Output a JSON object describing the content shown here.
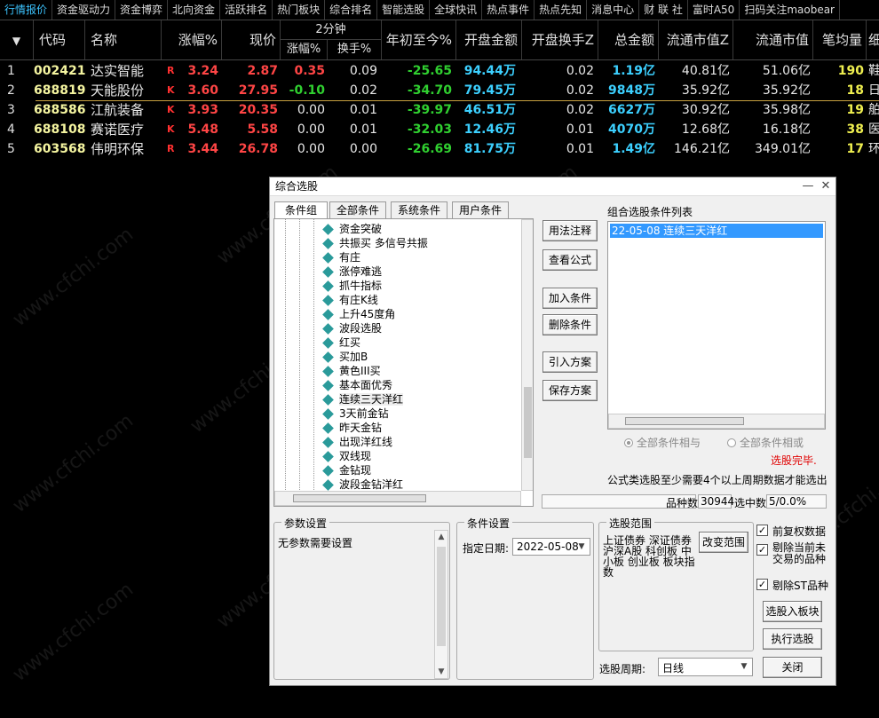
{
  "nav": [
    "行情报价",
    "资金驱动力",
    "资金博弈",
    "北向资金",
    "活跃排名",
    "热门板块",
    "综合排名",
    "智能选股",
    "全球快讯",
    "热点事件",
    "热点先知",
    "消息中心",
    "财 联 社",
    "富时A50",
    "扫码关注maobear"
  ],
  "header": {
    "code": "代码",
    "name": "名称",
    "change_pct": "涨幅%",
    "price": "现价",
    "two_min": "2分钟",
    "two_min_change": "涨幅%",
    "turnover": "换手%",
    "ytd": "年初至今%",
    "open_amount": "开盘金额",
    "open_turnover": "开盘换手Z",
    "total_amount": "总金额",
    "float_mv_z": "流通市值Z",
    "float_mv": "流通市值",
    "avg_per_trade": "笔均量",
    "last": "细"
  },
  "rows": [
    {
      "idx": "1",
      "code": "002421",
      "name": "达实智能",
      "mark": "R",
      "chg": "3.24",
      "price": "2.87",
      "m2": "0.35",
      "turn": "0.09",
      "ytd": "-25.65",
      "open_amt": "94.44",
      "open_amt_u": "万",
      "open_turn": "0.02",
      "total": "1.19",
      "total_u": "亿",
      "fmvz": "40.81亿",
      "fmv": "51.06亿",
      "avg": "190",
      "tail": "鞋"
    },
    {
      "idx": "2",
      "code": "688819",
      "name": "天能股份",
      "mark": "K",
      "chg": "3.60",
      "price": "27.95",
      "m2": "-0.10",
      "turn": "0.02",
      "ytd": "-34.70",
      "open_amt": "79.45",
      "open_amt_u": "万",
      "open_turn": "0.02",
      "total": "9848",
      "total_u": "万",
      "fmvz": "35.92亿",
      "fmv": "35.92亿",
      "avg": "18",
      "tail": "日"
    },
    {
      "idx": "3",
      "code": "688586",
      "name": "江航装备",
      "mark": "K",
      "chg": "3.93",
      "price": "20.35",
      "m2": "0.00",
      "turn": "0.01",
      "ytd": "-39.97",
      "open_amt": "46.51",
      "open_amt_u": "万",
      "open_turn": "0.02",
      "total": "6627",
      "total_u": "万",
      "fmvz": "30.92亿",
      "fmv": "35.98亿",
      "avg": "19",
      "tail": "舶"
    },
    {
      "idx": "4",
      "code": "688108",
      "name": "赛诺医疗",
      "mark": "K",
      "chg": "5.48",
      "price": "5.58",
      "m2": "0.00",
      "turn": "0.01",
      "ytd": "-32.03",
      "open_amt": "12.46",
      "open_amt_u": "万",
      "open_turn": "0.01",
      "total": "4070",
      "total_u": "万",
      "fmvz": "12.68亿",
      "fmv": "16.18亿",
      "avg": "38",
      "tail": "医"
    },
    {
      "idx": "5",
      "code": "603568",
      "name": "伟明环保",
      "mark": "R",
      "chg": "3.44",
      "price": "26.78",
      "m2": "0.00",
      "turn": "0.00",
      "ytd": "-26.69",
      "open_amt": "81.75",
      "open_amt_u": "万",
      "open_turn": "0.01",
      "total": "1.49",
      "total_u": "亿",
      "fmvz": "146.21亿",
      "fmv": "349.01亿",
      "avg": "17",
      "tail": "环"
    }
  ],
  "watermark": "www.cfchi.com",
  "dialog": {
    "title": "综合选股",
    "tabs": [
      "条件组",
      "全部条件",
      "系统条件",
      "用户条件"
    ],
    "tree_items": [
      "资金突破",
      "共振买 多信号共振",
      "有庄",
      "涨停难逃",
      "抓牛指标",
      "有庄K线",
      "上升45度角",
      "波段选股",
      "红买",
      "买加B",
      "黄色III买",
      "基本面优秀",
      "连续三天洋红",
      "3天前金钻",
      "昨天金钻",
      "出现洋红线",
      "双线现",
      "金钻现",
      "波段金钻洋红"
    ],
    "btn_usage": "用法注释",
    "btn_formula": "查看公式",
    "btn_add": "加入条件",
    "btn_delete": "删除条件",
    "btn_import": "引入方案",
    "btn_save": "保存方案",
    "list_title": "组合选股条件列表",
    "list_items": [
      "22-05-08 连续三天洋红"
    ],
    "radio_and": "全部条件相与",
    "radio_or": "全部条件相或",
    "status_done": "选股完毕.",
    "note": "公式类选股至少需要4个以上周期数据才能选出",
    "count_label": "品种数",
    "count_value": "30944",
    "selected_label": "选中数",
    "selected_value": "5/0.0%",
    "param_title": "参数设置",
    "param_text": "无参数需要设置",
    "cond_title": "条件设置",
    "date_label": "指定日期:",
    "date_value": "2022-05-08",
    "range_title": "选股范围",
    "range_text": "上证债券 深证债券 沪深A股 科创板 中小板 创业板 板块指数",
    "btn_change_range": "改变范围",
    "chk_restore": "前复权数据",
    "chk_exclude_untraded": "剔除当前未交易的品种",
    "chk_exclude_st": "剔除ST品种",
    "btn_to_block": "选股入板块",
    "btn_run": "执行选股",
    "btn_close": "关闭",
    "period_label": "选股周期:",
    "period_value": "日线"
  }
}
